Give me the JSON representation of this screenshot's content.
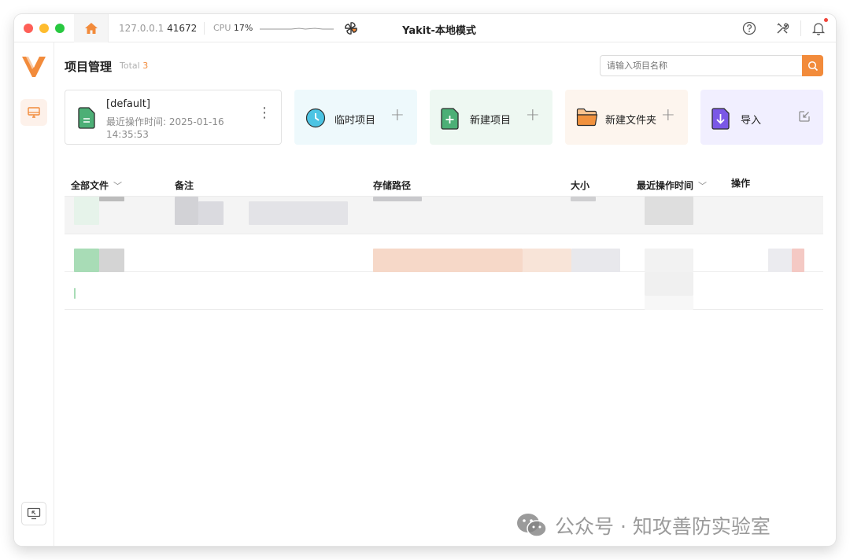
{
  "titlebar": {
    "address": "127.0.0.1",
    "port": "41672",
    "cpu_label": "CPU",
    "cpu_value": "17%",
    "app_title": "Yakit-本地模式"
  },
  "header": {
    "title": "项目管理",
    "total_label": "Total",
    "total_count": "3",
    "search_placeholder": "请输入项目名称"
  },
  "current_project": {
    "name": "[default]",
    "time_label": "最近操作时间:",
    "time_value": "2025-01-16 14:35:53"
  },
  "actions": [
    {
      "label": "临时项目",
      "icon": "clock-icon",
      "color": "#4cc4e3"
    },
    {
      "label": "新建项目",
      "icon": "new-doc-icon",
      "color": "#4caf76"
    },
    {
      "label": "新建文件夹",
      "icon": "folder-icon",
      "color": "#f0913e"
    },
    {
      "label": "导入",
      "icon": "import-icon",
      "color": "#7a58e6"
    }
  ],
  "table": {
    "columns": [
      "全部文件",
      "备注",
      "存储路径",
      "大小",
      "最近操作时间",
      "操作"
    ]
  },
  "watermark": "公众号 · 知攻善防实验室",
  "colors": {
    "accent": "#f28b3b",
    "selected_row": "#f4f4f4"
  }
}
